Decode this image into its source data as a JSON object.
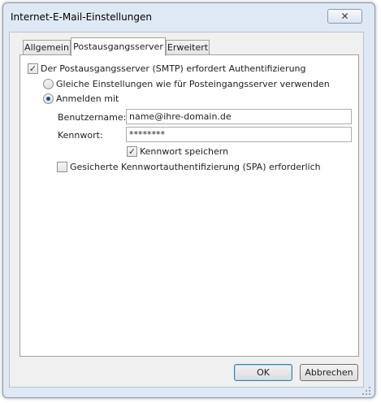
{
  "window": {
    "title": "Internet-E-Mail-Einstellungen",
    "close_label": "✕"
  },
  "tabs": [
    {
      "label": "Allgemein",
      "active": false
    },
    {
      "label": "Postausgangsserver",
      "active": true
    },
    {
      "label": "Erweitert",
      "active": false
    }
  ],
  "smtp_auth": {
    "label": "Der Postausgangsserver (SMTP) erfordert Authentifizierung",
    "checked": true
  },
  "radio_same": {
    "label": "Gleiche Einstellungen wie für Posteingangsserver verwenden",
    "selected": false
  },
  "radio_login": {
    "label": "Anmelden mit",
    "selected": true
  },
  "username": {
    "label": "Benutzername:",
    "value": "name@ihre-domain.de"
  },
  "password": {
    "label": "Kennwort:",
    "value": "********"
  },
  "save_password": {
    "label": "Kennwort speichern",
    "checked": true
  },
  "spa": {
    "label": "Gesicherte Kennwortauthentifizierung (SPA) erforderlich",
    "checked": false
  },
  "buttons": {
    "ok": "OK",
    "cancel": "Abbrechen"
  }
}
